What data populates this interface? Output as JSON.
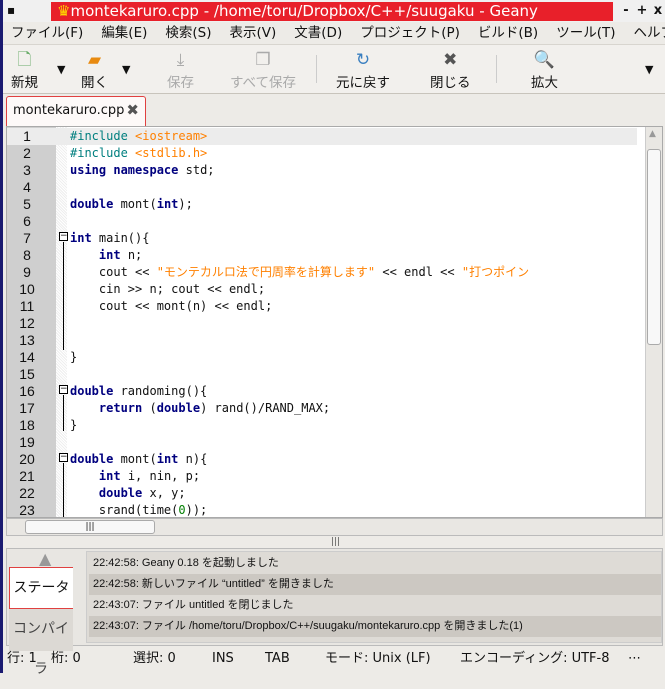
{
  "window": {
    "title": "montekaruro.cpp - /home/toru/Dropbox/C++/suugaku - Geany",
    "minimize": "-",
    "maximize": "+",
    "close": "x",
    "title_color": "#e8202a"
  },
  "menu": [
    "ファイル(F)",
    "編集(E)",
    "検索(S)",
    "表示(V)",
    "文書(D)",
    "プロジェクト(P)",
    "ビルド(B)",
    "ツール(T)",
    "ヘルプ("
  ],
  "toolbar": {
    "new": "新規",
    "open": "開く",
    "save": "保存",
    "save_all": "すべて保存",
    "revert": "元に戻す",
    "close": "閉じる",
    "zoom_in": "拡大",
    "dropdown": "▼"
  },
  "tab": {
    "label": "montekaruro.cpp",
    "close": "✖"
  },
  "editor": {
    "lines": [
      [
        [
          "#include ",
          "pp"
        ],
        [
          "<iostream>",
          "str"
        ]
      ],
      [
        [
          "#include ",
          "pp"
        ],
        [
          "<stdlib.h>",
          "str"
        ]
      ],
      [
        [
          "using",
          "kw"
        ],
        [
          " ",
          ""
        ],
        [
          "namespace",
          "kw"
        ],
        [
          " std;",
          ""
        ]
      ],
      [],
      [
        [
          "double",
          "kw"
        ],
        [
          " mont(",
          ""
        ],
        [
          "int",
          "kw"
        ],
        [
          ");",
          ""
        ]
      ],
      [],
      [
        [
          "int",
          "kw"
        ],
        [
          " main(){",
          ""
        ]
      ],
      [
        [
          "    ",
          ""
        ],
        [
          "int",
          "kw"
        ],
        [
          " n;",
          ""
        ]
      ],
      [
        [
          "    cout << ",
          ""
        ],
        [
          "\"モンテカルロ法で円周率を計算します\"",
          "str"
        ],
        [
          " << endl << ",
          ""
        ],
        [
          "\"打つポイン",
          "str"
        ]
      ],
      [
        [
          "    cin >> n; cout << endl;",
          ""
        ]
      ],
      [
        [
          "    cout << mont(n) << endl;",
          ""
        ]
      ],
      [],
      [],
      [
        [
          "}",
          ""
        ]
      ],
      [],
      [
        [
          "double",
          "kw"
        ],
        [
          " randoming(){",
          ""
        ]
      ],
      [
        [
          "    ",
          ""
        ],
        [
          "return",
          "kw"
        ],
        [
          " (",
          ""
        ],
        [
          "double",
          "kw"
        ],
        [
          ") rand()/RAND_MAX;",
          ""
        ]
      ],
      [
        [
          "}",
          ""
        ]
      ],
      [],
      [
        [
          "double",
          "kw"
        ],
        [
          " mont(",
          ""
        ],
        [
          "int",
          "kw"
        ],
        [
          " n){",
          ""
        ]
      ],
      [
        [
          "    ",
          ""
        ],
        [
          "int",
          "kw"
        ],
        [
          " i, nin, p;",
          ""
        ]
      ],
      [
        [
          "    ",
          ""
        ],
        [
          "double",
          "kw"
        ],
        [
          " x, y;",
          ""
        ]
      ],
      [
        [
          "    srand(time(",
          ""
        ],
        [
          "0",
          "num"
        ],
        [
          "));",
          ""
        ]
      ]
    ]
  },
  "messages": {
    "tabs": [
      "ステータス",
      "コンパイラ"
    ],
    "items": [
      "22:42:58: Geany 0.18 を起動しました",
      "22:42:58: 新しいファイル “untitled” を開きました",
      "22:43:07: ファイル untitled を閉じました",
      "22:43:07: ファイル /home/toru/Dropbox/C++/suugaku/montekaruro.cpp を開きました(1)"
    ]
  },
  "status": {
    "line": "行: 1",
    "col": "桁: 0",
    "sel": "選択: 0",
    "ins": "INS",
    "tab": "TAB",
    "mode": "モード: Unix (LF)",
    "enc": "エンコーディング: UTF-8",
    "more": "⋯"
  }
}
